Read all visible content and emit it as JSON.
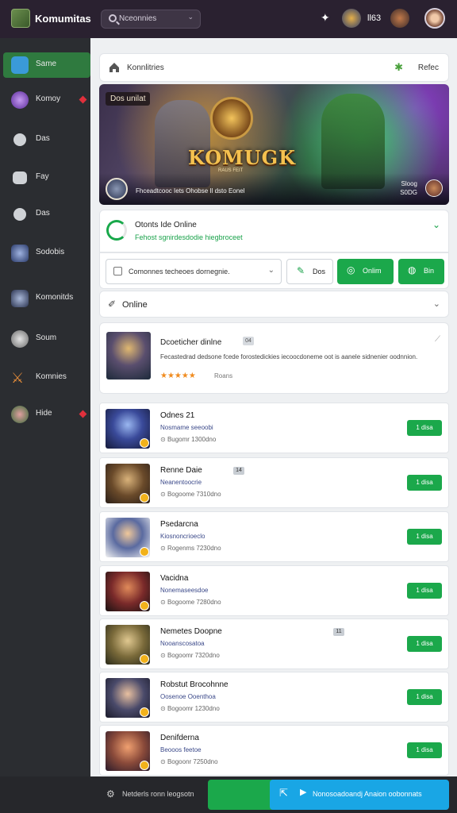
{
  "topbar": {
    "app_title": "Komumitas",
    "search_text": "Nceonnies",
    "label": "ll63"
  },
  "sidebar": {
    "items": [
      {
        "label": "Same",
        "icon": "grid-icon",
        "active": true
      },
      {
        "label": "Komoy",
        "icon": "orb-icon",
        "alert": true
      },
      {
        "label": "Das",
        "icon": "chat-bubble-icon"
      },
      {
        "label": "Fay",
        "icon": "card-icon"
      },
      {
        "label": "Das",
        "icon": "chat-bubble-icon"
      },
      {
        "label": "Sodobis",
        "icon": "avatar-icon"
      },
      {
        "label": "Komonitds",
        "icon": "avatar-icon"
      },
      {
        "label": "Soum",
        "icon": "circle-icon"
      },
      {
        "label": "Komnies",
        "icon": "sword-icon"
      },
      {
        "label": "Hide",
        "icon": "avatar-icon",
        "alert": true
      }
    ]
  },
  "breadcrumb": {
    "text": "Konnlitries",
    "refresh_label": "Refec"
  },
  "banner": {
    "tag": "Dos unilat",
    "title": "KOMUGK",
    "subtitle": "RAUS FEIT",
    "caption": "Fhceadtcooc Iets Ohobse Il dsto Eonel",
    "count_line1": "Sloog",
    "count_line2": "S0DG"
  },
  "status": {
    "title": "Otonts Ide Online",
    "subtitle": "Fehost sgnirdesdodie hiegbroceet"
  },
  "actions": {
    "select_text": "Comonnes techeoes dornegnie.",
    "btn_outline": "Dos",
    "btn_online": "Onlim",
    "btn_bin": "Bin"
  },
  "online_header": {
    "label": "Online"
  },
  "featured": {
    "title": "Dcoeticher dinlne",
    "badge": "04",
    "description": "Fecastedrad dedsone fcede forostedickies iecoocdoneme oot is aanele sidnenier oodnnion.",
    "stars": "★★★★★",
    "reviews": "Roans"
  },
  "items": [
    {
      "name": "Odnes 21",
      "badge": "",
      "role": "Nosmame seeoobi",
      "meta": "Bugomr 1300dno",
      "join": "1 disa"
    },
    {
      "name": "Renne Daie",
      "badge": "14",
      "role": "Neanentoocrie",
      "meta": "Bogoome 7310dno",
      "join": "1 disa"
    },
    {
      "name": "Psedarcna",
      "badge": "",
      "role": "Kiosnoncrioeclo",
      "meta": "Rogenms 7230dno",
      "join": "1 disa"
    },
    {
      "name": "Vacidna",
      "badge": "",
      "role": "Nonemaseesdoe",
      "meta": "Bogoome 7280dno",
      "join": "1 disa"
    },
    {
      "name": "Nemetes Doopne",
      "badge": "11",
      "role": "Nooanscosatoa",
      "meta": "Bogoomr 7320dno",
      "join": "1 disa"
    },
    {
      "name": "Robstut Brocohnne",
      "badge": "",
      "role": "Oosenoe Ooenthoa",
      "meta": "Bogoomr 1230dno",
      "join": "1 disa"
    },
    {
      "name": "Denifderna",
      "badge": "",
      "role": "Beooos feetoe",
      "meta": "Bogoonr 7250dno",
      "join": "1 disa"
    }
  ],
  "bottombar": {
    "left_text": "Netderls ronn leogsotn",
    "cta_text": "Nonosoadoandj Anaion oobonnats"
  },
  "colors": {
    "accent_green": "#1ba84b",
    "cta_blue": "#19a6e5",
    "topbar_bg": "#2a2130",
    "sidebar_bg": "#2b2d31"
  }
}
